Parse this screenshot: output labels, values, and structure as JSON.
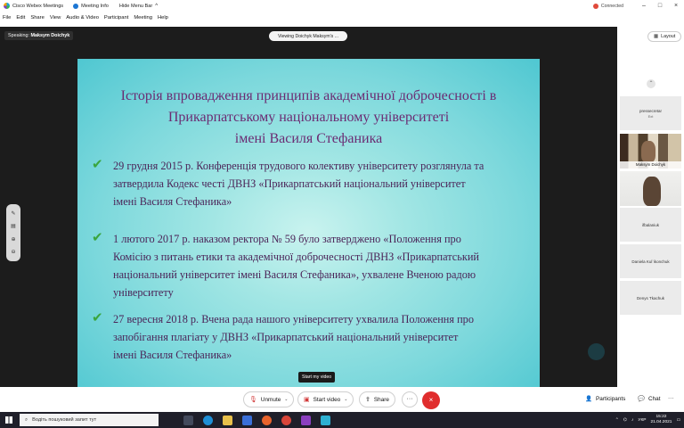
{
  "titlebar": {
    "app_name": "Cisco Webex Meetings",
    "meeting_info": "Meeting Info",
    "hide_menu": "Hide Menu Bar",
    "hide_menu_chevron": "^",
    "connected": "Connected",
    "minimize": "–",
    "maximize": "□",
    "close": "×"
  },
  "menu": [
    "File",
    "Edit",
    "Share",
    "View",
    "Audio & Video",
    "Participant",
    "Meeting",
    "Help"
  ],
  "stage": {
    "speaking_label": "Speaking:",
    "speaking_name": "Maksym Doichyk",
    "viewing": "Viewing Doichyk Maksym's ...",
    "layout": "Layout",
    "tooltip": "Start my video"
  },
  "slide": {
    "title_lines": [
      "Історія впровадження принципів академічної доброчесності в",
      "Прикарпатському національному університеті",
      "імені Василя Стефаника"
    ],
    "items": [
      {
        "lines": [
          "29 грудня 2015 р. Конференція трудового колективу університету розглянула та",
          "затвердила Кодекс честі ДВНЗ «Прикарпатський національний університет",
          "імені Василя Стефаника»"
        ]
      },
      {
        "lines": [
          "1 лютого 2017 р. наказом ректора № 59 було затверджено «Положення про",
          "Комісію з питань етики та академічної доброчесності ДВНЗ «Прикарпатський",
          "національний університет імені Василя Стефаника», ухвалене Вченою радою",
          "університету"
        ]
      },
      {
        "lines": [
          "27 вересня 2018 р. Вчена рада нашого університету ухвалила Положення про",
          "запобігання плагіату  у ДВНЗ «Прикарпатський національний університет",
          "імені Василя Стефаника»"
        ]
      }
    ]
  },
  "participants": [
    {
      "name": "pressecretar",
      "sub": "Ext"
    },
    {
      "name": "Maksym Doichyk"
    },
    {
      "name": "ifbalaniuk"
    },
    {
      "name": "Daniela Kul`ikonchuk"
    },
    {
      "name": "Denys Tkachuk"
    }
  ],
  "controls": {
    "unmute": "Unmute",
    "start_video": "Start video",
    "share": "Share",
    "more": "···",
    "participants": "Participants",
    "chat": "Chat",
    "more_right": "···"
  },
  "taskbar": {
    "search_placeholder": "Водіть пошуковий запит тут",
    "lang": "УКР",
    "time": "15:22",
    "date": "21.04.2021"
  },
  "colors": {
    "slide_title": "#6b2b72",
    "slide_text": "#4b2458",
    "check": "#3aa53e",
    "leave": "#e02d2d"
  }
}
